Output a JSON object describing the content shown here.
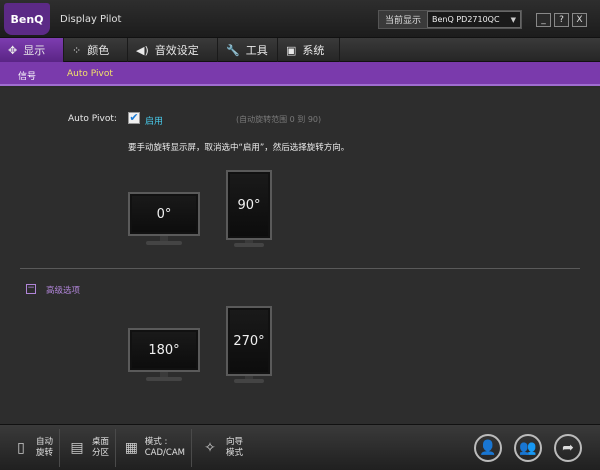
{
  "app": {
    "brand": "BenQ",
    "title": "Display Pilot",
    "current_display_label": "当前显示",
    "current_display_value": "BenQ PD2710QC",
    "window_buttons": [
      "_",
      "?",
      "X"
    ]
  },
  "tabs": [
    {
      "label": "显示",
      "icon": "display-icon",
      "glyph": "✥"
    },
    {
      "label": "颜色",
      "icon": "color-icon",
      "glyph": "⁘"
    },
    {
      "label": "音效设定",
      "icon": "speaker-icon",
      "glyph": "◀)"
    },
    {
      "label": "工具",
      "icon": "wrench-icon",
      "glyph": "🔧"
    },
    {
      "label": "系统",
      "icon": "system-icon",
      "glyph": "▣"
    }
  ],
  "subtabs": [
    {
      "label": "信号"
    },
    {
      "label": "Auto Pivot"
    }
  ],
  "pivot": {
    "label": "Auto Pivot:",
    "checked": "✔",
    "enable_label": "启用",
    "range_note": "(自动旋转范围 0 到 90)",
    "instruction": "要手动旋转显示屏，取消选中“启用”，然后选择旋转方向。"
  },
  "advanced": {
    "toggle": "−",
    "label": "高级选项"
  },
  "orientations": [
    "0°",
    "90°",
    "180°",
    "270°"
  ],
  "bottom": [
    {
      "label": "自动\n旋转",
      "icon": "auto-rotate-icon",
      "glyph": "▯"
    },
    {
      "label": "桌面\n分区",
      "icon": "desktop-partition-icon",
      "glyph": "▤"
    },
    {
      "label": "模式 :\nCAD/CAM",
      "icon": "cad-mode-icon",
      "glyph": "▦"
    },
    {
      "label": "向导\n模式",
      "icon": "wizard-icon",
      "glyph": "✧"
    }
  ],
  "bottom_icons": [
    {
      "icon": "user-icon",
      "glyph": "👤"
    },
    {
      "icon": "users-icon",
      "glyph": "👥"
    },
    {
      "icon": "share-icon",
      "glyph": "➦"
    }
  ],
  "colors": {
    "accent_purple": "#7a3aac",
    "active_tab": "#6a2f98",
    "subtab_active": "#f2e36a",
    "enable_cyan": "#48c8e8"
  }
}
